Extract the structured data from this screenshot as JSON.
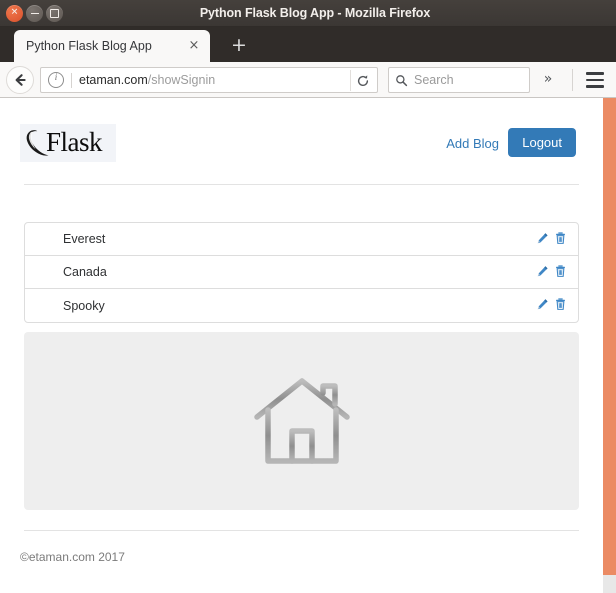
{
  "window": {
    "title": "Python Flask Blog App - Mozilla Firefox",
    "controls": {
      "close": "close-button",
      "minimize": "minimize-button",
      "maximize": "maximize-button"
    }
  },
  "browser": {
    "tab": {
      "label": "Python Flask Blog App",
      "close_glyph": "×"
    },
    "new_tab_glyph": "+",
    "urlbar": {
      "host": "etaman.com",
      "path": "/showSignin",
      "info_icon": "site-info-icon",
      "reload_icon": "reload-icon"
    },
    "search": {
      "placeholder": "Search",
      "icon": "search-icon"
    },
    "overflow_glyph": "»",
    "menu_icon": "hamburger-menu-icon"
  },
  "site": {
    "brand": {
      "wordmark": "Flask",
      "logo_icon": "flask-horn-logo"
    },
    "nav": {
      "add_blog": "Add Blog",
      "logout": "Logout"
    },
    "blogs": [
      {
        "title": "Everest",
        "edit_icon": "pencil-icon",
        "delete_icon": "trash-icon"
      },
      {
        "title": "Canada",
        "edit_icon": "pencil-icon",
        "delete_icon": "trash-icon"
      },
      {
        "title": "Spooky",
        "edit_icon": "pencil-icon",
        "delete_icon": "trash-icon"
      }
    ],
    "placeholder_image": {
      "icon": "house-icon"
    },
    "footer": "©etaman.com 2017"
  },
  "colors": {
    "accent_blue": "#337ab7",
    "titlebar": "#3b3734",
    "desktop_orange": "#eb8b64",
    "panel_gray": "#eeeeee"
  }
}
